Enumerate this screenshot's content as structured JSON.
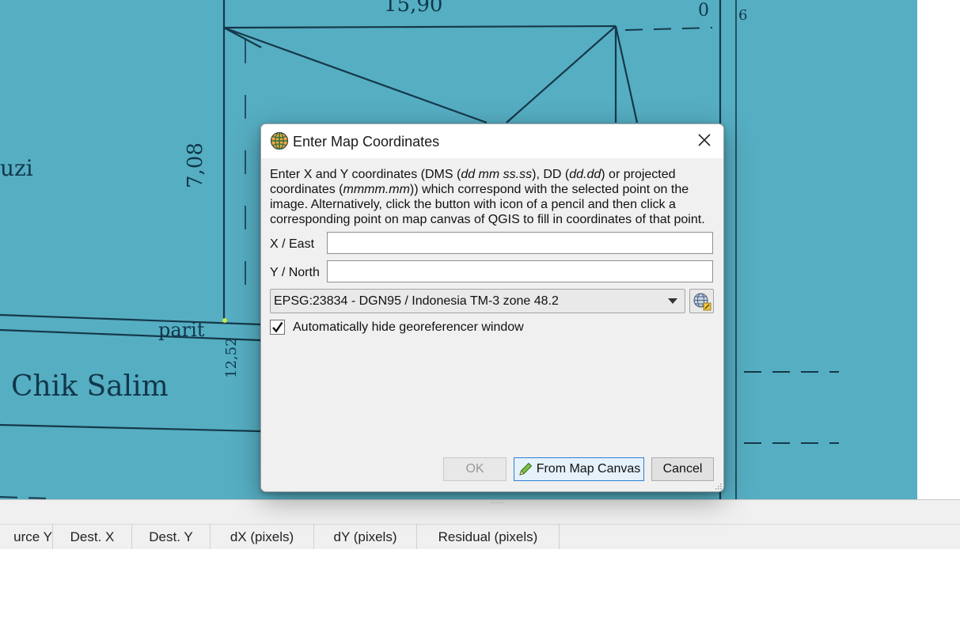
{
  "dialog": {
    "title": "Enter Map Coordinates",
    "description_parts": {
      "p1": "Enter X and Y coordinates (DMS (",
      "p2": "dd mm ss.ss",
      "p3": "), DD (",
      "p4": "dd.dd",
      "p5": ") or projected coordinates (",
      "p6": "mmmm.mm",
      "p7": ")) which correspond with the selected point on the image. Alternatively, click the button with icon of a pencil and then click a corresponding point on map canvas of QGIS to fill in coordinates of that point."
    },
    "x_label": "X / East",
    "x_value": "",
    "y_label": "Y / North",
    "y_value": "",
    "crs_selected": "EPSG:23834 - DGN95 / Indonesia TM-3 zone 48.2",
    "auto_hide_label": "Automatically hide georeferencer window",
    "auto_hide_checked": true,
    "ok_label": "OK",
    "from_canvas_label": "From Map Canvas",
    "cancel_label": "Cancel"
  },
  "table": {
    "columns": [
      "urce Y",
      "Dest. X",
      "Dest. Y",
      "dX (pixels)",
      "dY (pixels)",
      "Residual (pixels)"
    ]
  },
  "sketch": {
    "labels": [
      "15,90",
      "7,08",
      "uzi",
      "parit",
      "12,52",
      "Chik Salim",
      "6",
      "0"
    ]
  },
  "colors": {
    "canvas_bg": "#56aec3",
    "dialog_bg": "#f0f0f0",
    "accent": "#2d7fd3"
  },
  "icons": {
    "app": "georeferencer-globe-icon",
    "close": "close-icon",
    "dropdown": "chevron-down-icon",
    "crs": "crs-globe-icon",
    "pencil": "pencil-icon"
  }
}
